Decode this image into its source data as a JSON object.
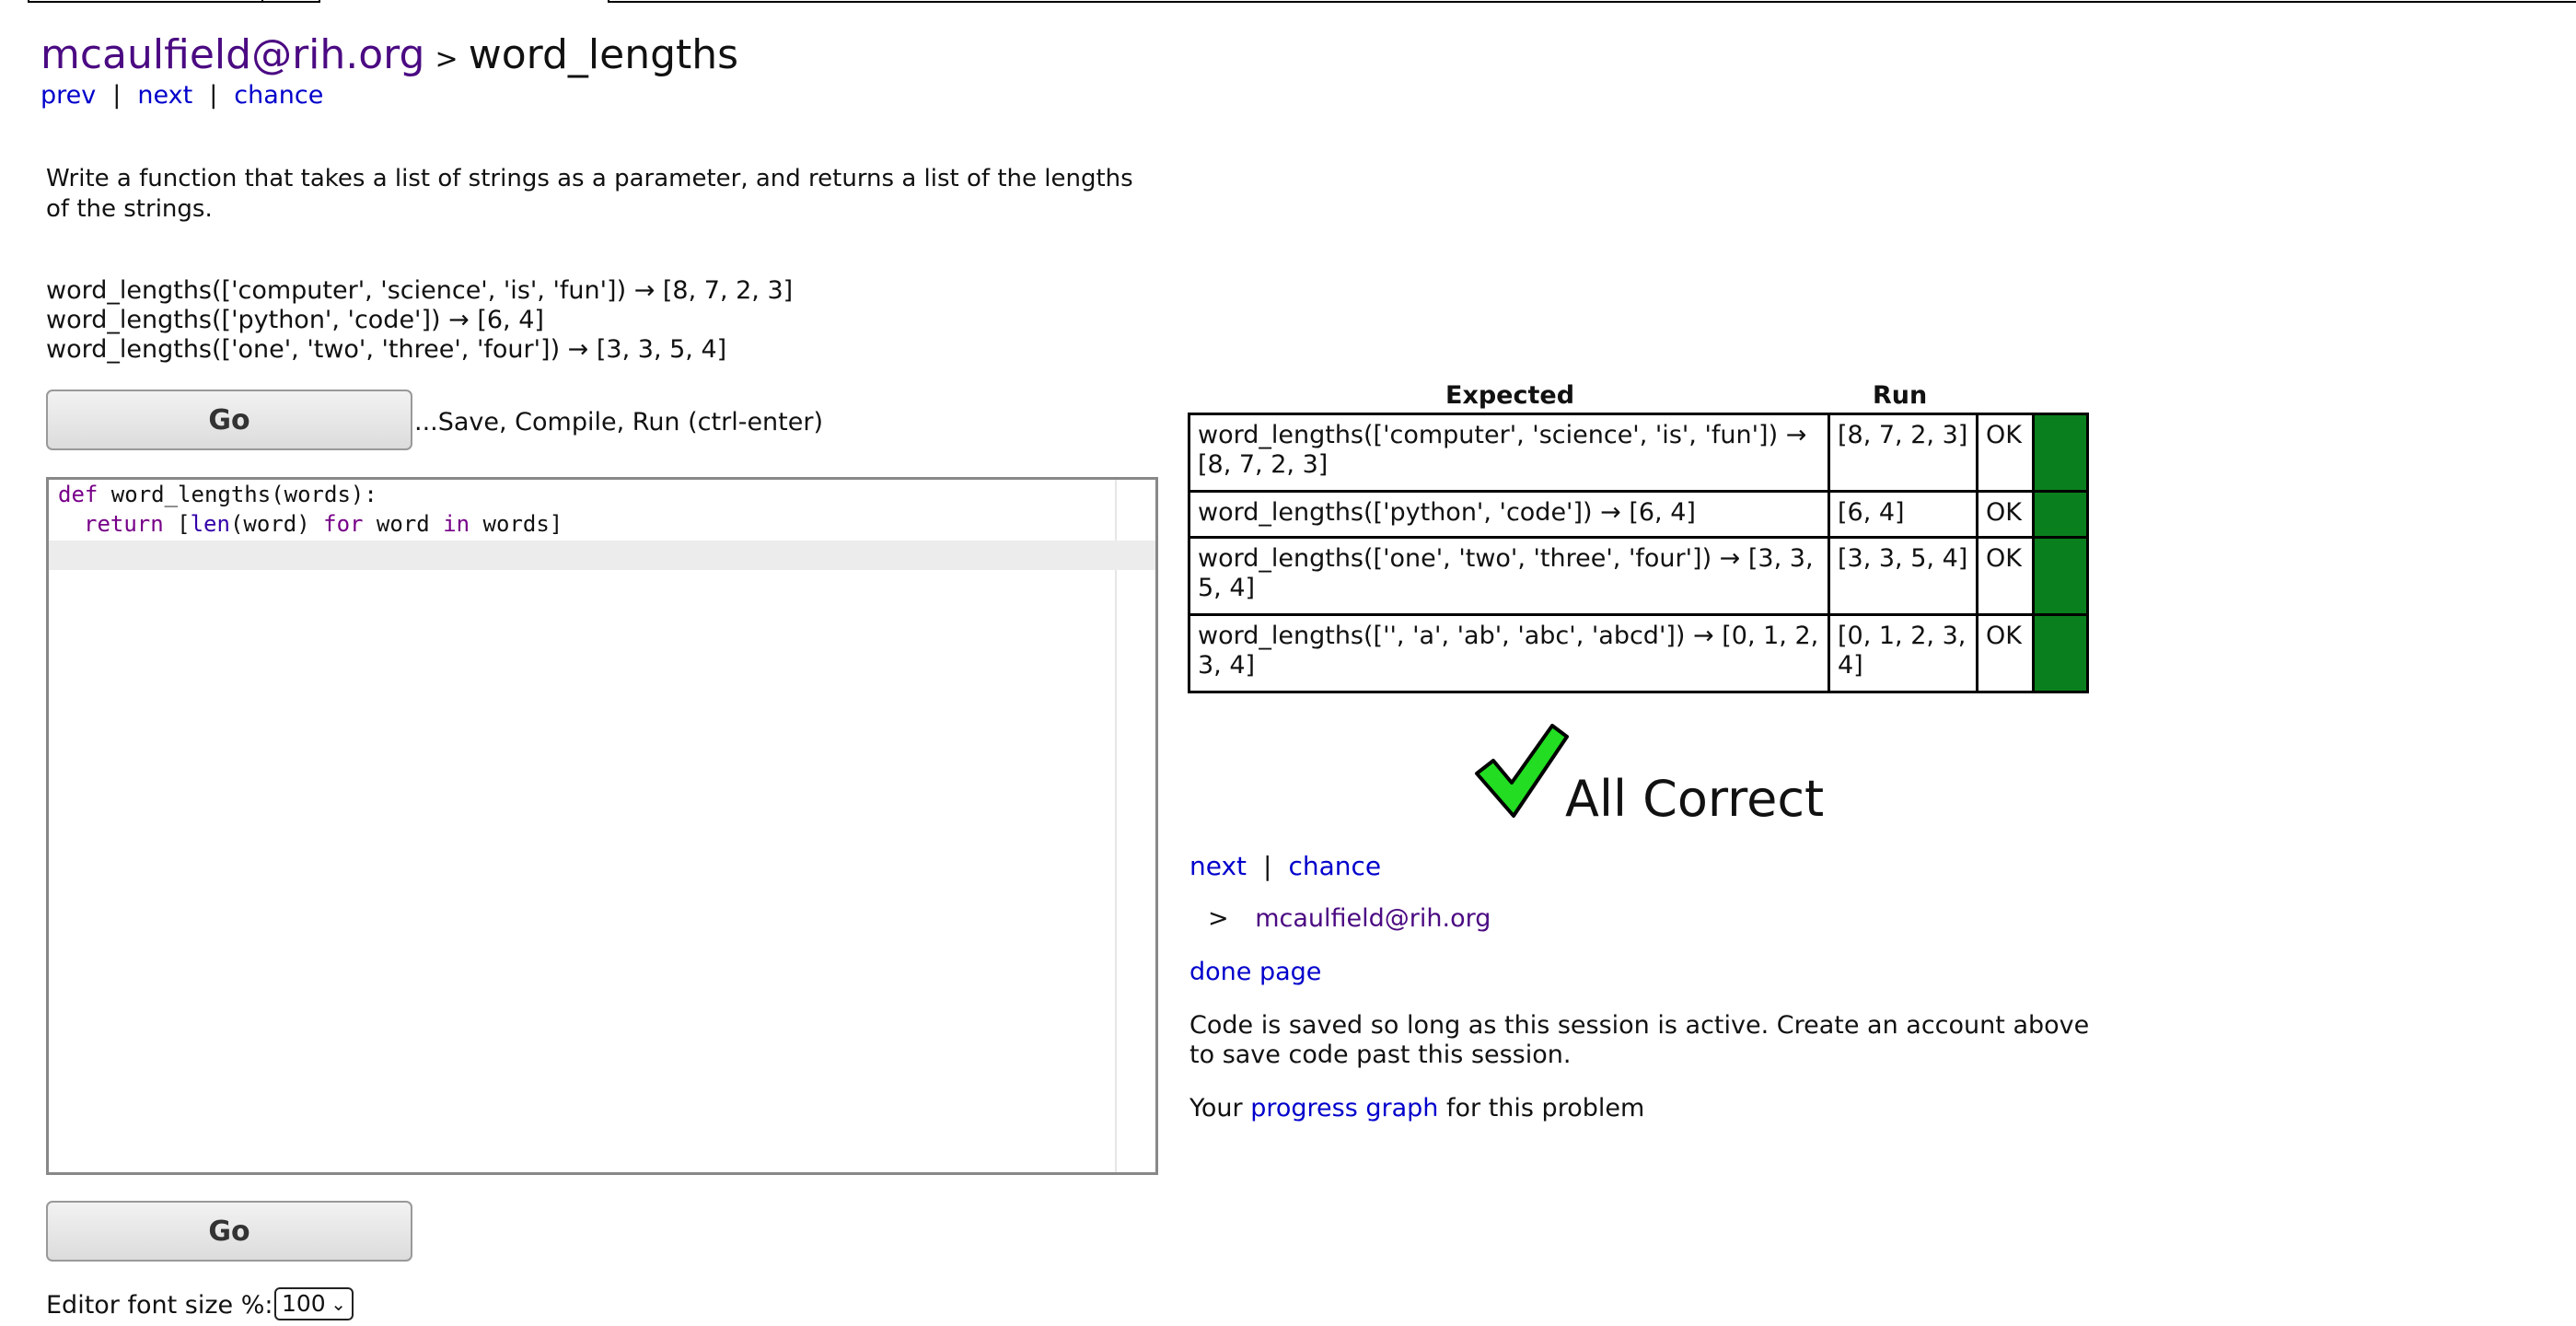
{
  "breadcrumb": {
    "user": "mcaulfield@rih.org",
    "separator": ">",
    "problem": "word_lengths"
  },
  "nav": {
    "prev": "prev",
    "next": "next",
    "chance": "chance",
    "sep": "|"
  },
  "prompt": {
    "line1": "Write a function that takes a list of strings as a parameter, and returns a list of the lengths",
    "line2": "of the strings."
  },
  "examples": [
    "word_lengths(['computer', 'science', 'is', 'fun']) → [8, 7, 2, 3]",
    "word_lengths(['python', 'code']) → [6, 4]",
    "word_lengths(['one', 'two', 'three', 'four']) → [3, 3, 5, 4]"
  ],
  "go_button": "Go",
  "go_hint": "...Save, Compile, Run (ctrl-enter)",
  "editor": {
    "kw_def": "def",
    "def_rest": " word_lengths(words):",
    "kw_return": "return",
    "bracket_open": " [",
    "bi_len": "len",
    "mid": "(word) ",
    "kw_for": "for",
    "var": " word ",
    "kw_in": "in",
    "tail": " words]"
  },
  "font_size": {
    "label": "Editor font size %:",
    "value": "100"
  },
  "results": {
    "header_expected": "Expected",
    "header_run": "Run",
    "rows": [
      {
        "expected": "word_lengths(['computer', 'science', 'is', 'fun']) → [8, 7, 2, 3]",
        "run": "[8, 7, 2, 3]",
        "status": "OK"
      },
      {
        "expected": "word_lengths(['python', 'code']) → [6, 4]",
        "run": "[6, 4]",
        "status": "OK"
      },
      {
        "expected": "word_lengths(['one', 'two', 'three', 'four']) → [3, 3, 5, 4]",
        "run": "[3, 3, 5, 4]",
        "status": "OK"
      },
      {
        "expected": "word_lengths(['', 'a', 'ab', 'abc', 'abcd']) → [0, 1, 2, 3, 4]",
        "run": "[0, 1, 2, 3, 4]",
        "status": "OK"
      }
    ],
    "pass_color": "#0a7f1e"
  },
  "all_correct": "All Correct",
  "checkmark_color": "#22dd22",
  "after": {
    "next": "next",
    "sep": "|",
    "chance": "chance",
    "gt": ">",
    "user": "mcaulfield@rih.org",
    "done_page": "done page",
    "saved_line1": "Code is saved so long as this session is active. Create an account above",
    "saved_line2": "to save code past this session.",
    "your": "Your ",
    "progress_graph": "progress graph",
    "for_problem": " for this problem"
  }
}
